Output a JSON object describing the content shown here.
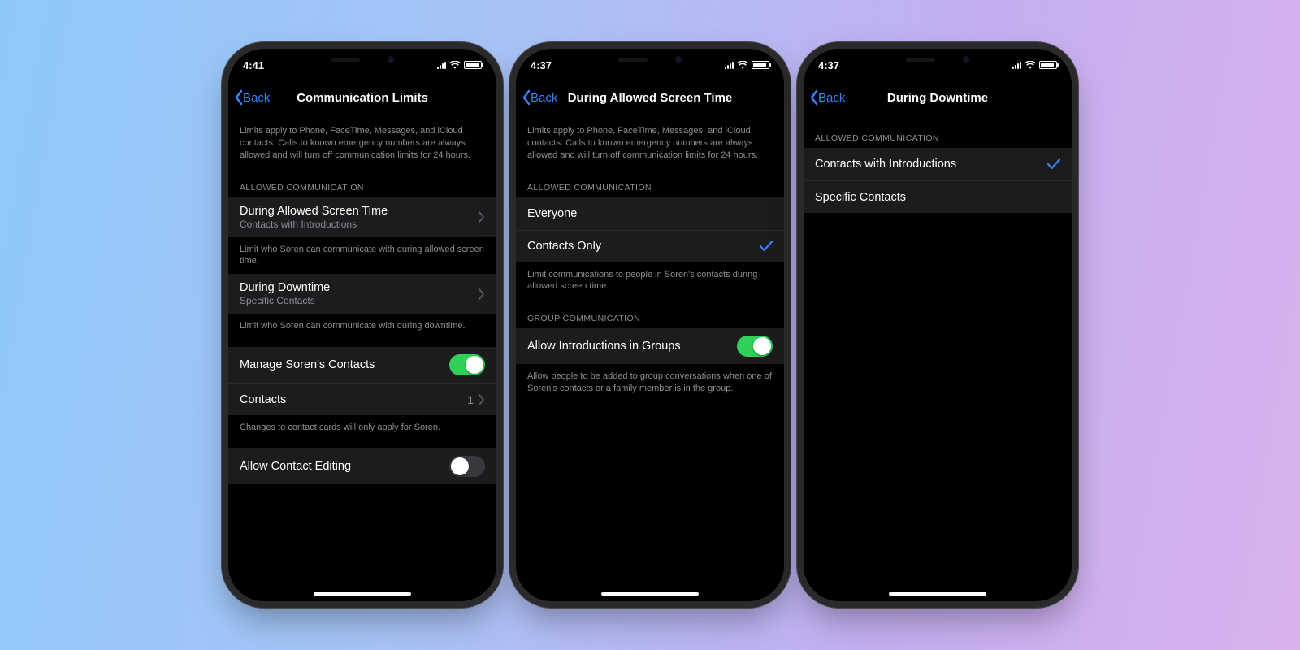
{
  "phones": [
    {
      "time": "4:41",
      "back": "Back",
      "title": "Communication Limits",
      "topDesc": "Limits apply to Phone, FaceTime, Messages, and iCloud contacts. Calls to known emergency numbers are always allowed and will turn off communication limits for 24 hours.",
      "sec1Header": "ALLOWED COMMUNICATION",
      "row1": {
        "label": "During Allowed Screen Time",
        "sub": "Contacts with Introductions"
      },
      "row1Foot": "Limit who Soren can communicate with during allowed screen time.",
      "row2": {
        "label": "During Downtime",
        "sub": "Specific Contacts"
      },
      "row2Foot": "Limit who Soren can communicate with during downtime.",
      "row3": {
        "label": "Manage Soren's Contacts",
        "on": true
      },
      "row4": {
        "label": "Contacts",
        "value": "1"
      },
      "row4Foot": "Changes to contact cards will only apply for Soren.",
      "row5": {
        "label": "Allow Contact Editing",
        "on": false
      }
    },
    {
      "time": "4:37",
      "back": "Back",
      "title": "During Allowed Screen Time",
      "topDesc": "Limits apply to Phone, FaceTime, Messages, and iCloud contacts. Calls to known emergency numbers are always allowed and will turn off communication limits for 24 hours.",
      "sec1Header": "ALLOWED COMMUNICATION",
      "opt1": "Everyone",
      "opt2": "Contacts Only",
      "opt2Selected": true,
      "sec1Foot": "Limit communications to people in Soren's contacts during allowed screen time.",
      "sec2Header": "GROUP COMMUNICATION",
      "row1": {
        "label": "Allow Introductions in Groups",
        "on": true
      },
      "sec2Foot": "Allow people to be added to group conversations when one of Soren's contacts or a family member is in the group."
    },
    {
      "time": "4:37",
      "back": "Back",
      "title": "During Downtime",
      "sec1Header": "ALLOWED COMMUNICATION",
      "opt1": "Contacts with Introductions",
      "opt1Selected": true,
      "opt2": "Specific Contacts"
    }
  ]
}
